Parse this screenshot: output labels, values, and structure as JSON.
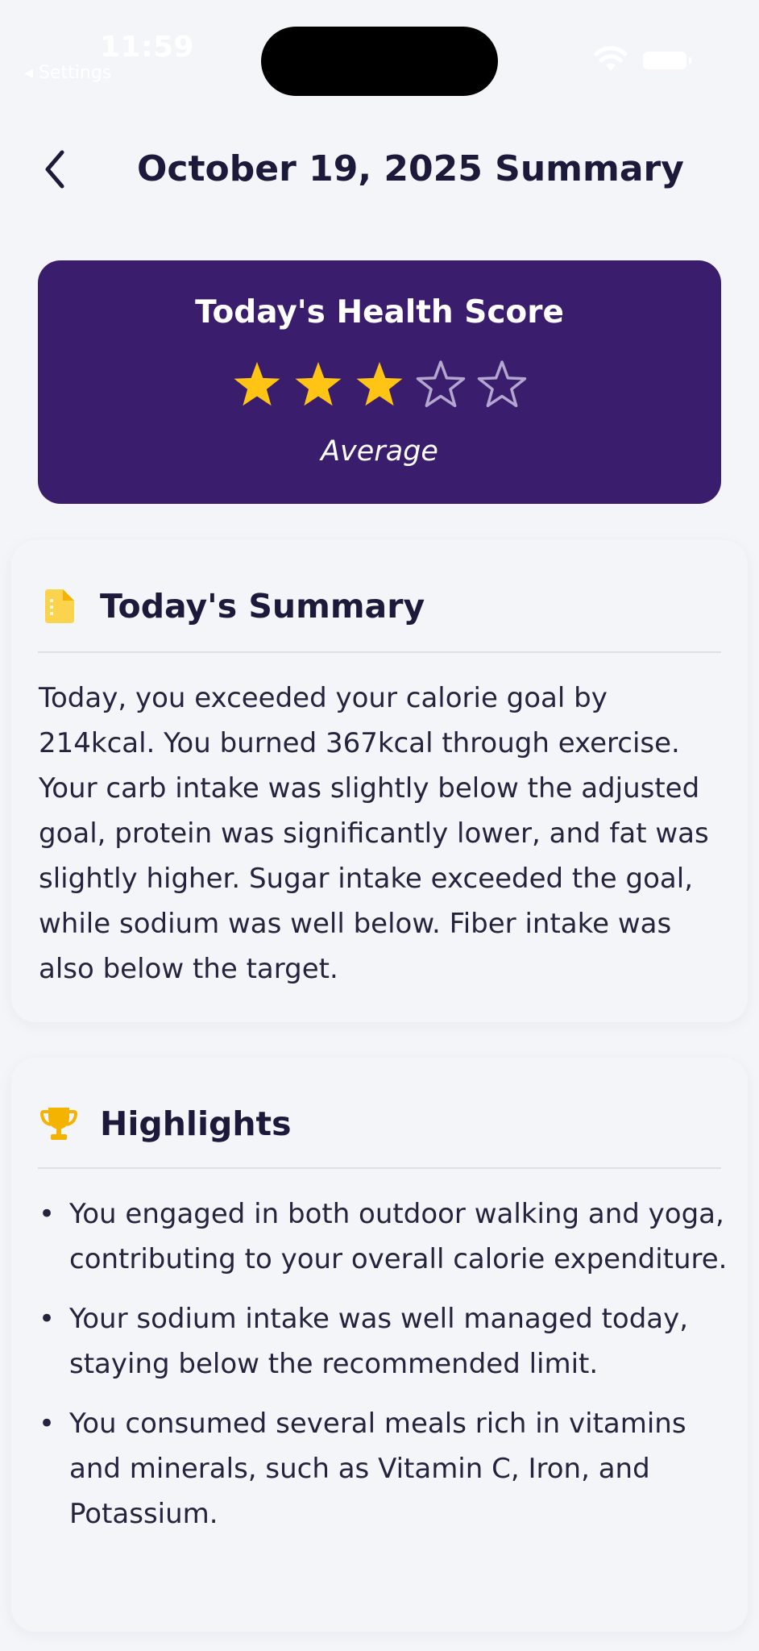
{
  "status_bar": {
    "time": "11:59",
    "back_app": "◂ Settings"
  },
  "header": {
    "title": "October 19, 2025 Summary",
    "back_icon": "chevron-left-icon"
  },
  "health_score": {
    "title": "Today's Health Score",
    "rating": 3,
    "max_rating": 5,
    "label": "Average",
    "card_color": "#3b1d6e",
    "star_filled_color": "#ffc414",
    "star_empty_color": "#b3a6cf"
  },
  "summary": {
    "icon": "document-icon",
    "title": "Today's Summary",
    "text": "Today, you exceeded your calorie goal by 214kcal. You burned 367kcal through exercise. Your carb intake was slightly below the adjusted goal, protein was significantly lower, and fat was slightly higher. Sugar intake exceeded the goal, while sodium was well below. Fiber intake was also below the target."
  },
  "highlights": {
    "icon": "trophy-icon",
    "title": "Highlights",
    "items": [
      "You engaged in both outdoor walking and yoga, contributing to your overall calorie expenditure.",
      "Your sodium intake was well managed today, staying below the recommended limit.",
      "You consumed several meals rich in vitamins and minerals, such as Vitamin C, Iron, and Potassium."
    ]
  }
}
